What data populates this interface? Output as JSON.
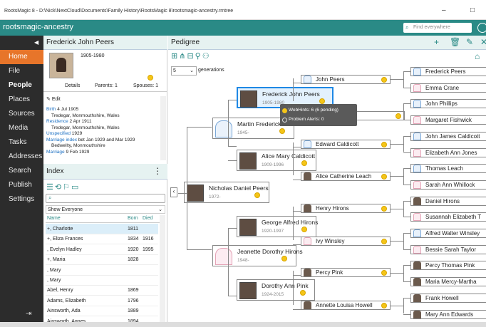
{
  "window": {
    "title": "RootsMagic 8 - D:\\Nick\\NextCloud\\Documents\\Family History\\RootsMagic 8\\rootsmagic-ancestry.rmtree",
    "minimize": "–",
    "restore": "□"
  },
  "appbar": {
    "name": "rootsmagic-ancestry",
    "search_placeholder": "Find everywhere"
  },
  "sidebar": {
    "items": [
      "Home",
      "File",
      "People",
      "Places",
      "Sources",
      "Media",
      "Tasks",
      "Addresses",
      "Search",
      "Publish",
      "Settings"
    ],
    "active": "Home",
    "current": "People"
  },
  "person": {
    "name": "Frederick John Peers",
    "years": "1905-1980",
    "tabs": {
      "details": "Details",
      "parents": "Parents: 1",
      "spouses": "Spouses: 1"
    },
    "edit": "Edit",
    "facts": [
      {
        "label": "Birth",
        "value": "4 Jul 1905"
      },
      {
        "label": "",
        "value": "Tredegar, Monmouthshire, Wales"
      },
      {
        "label": "Residence",
        "value": "2 Apr 1911"
      },
      {
        "label": "",
        "value": "Tredegar, Monmouthshire, Wales"
      },
      {
        "label": "Unspecified",
        "value": "1929"
      },
      {
        "label": "Marriage index",
        "value": "bet Jan 1929 and Mar 1929"
      },
      {
        "label": "",
        "value": "Bedwellty, Monmouthshire"
      },
      {
        "label": "Marriage",
        "value": "9 Feb 1929"
      }
    ]
  },
  "index": {
    "title": "Index",
    "filter": "Show Everyone",
    "cols": {
      "name": "Name",
      "born": "Born",
      "died": "Died"
    },
    "rows": [
      {
        "name": "+, Charlotte",
        "born": "1811",
        "died": ""
      },
      {
        "name": "+, Eliza Frances",
        "born": "1834",
        "died": "1916"
      },
      {
        "name": ", Evelyn Hadley",
        "born": "1920",
        "died": "1995"
      },
      {
        "name": "+, Maria",
        "born": "1828",
        "died": ""
      },
      {
        "name": ", Mary",
        "born": "",
        "died": ""
      },
      {
        "name": ", Mary",
        "born": "",
        "died": ""
      },
      {
        "name": "Abel, Henry",
        "born": "1869",
        "died": ""
      },
      {
        "name": "Adams, Elizabeth",
        "born": "1796",
        "died": ""
      },
      {
        "name": "Ainsworth, Ada",
        "born": "1889",
        "died": ""
      },
      {
        "name": "Ainsworth, Agnes",
        "born": "1894",
        "died": ""
      }
    ]
  },
  "pedigree": {
    "title": "Pedigree",
    "generations_value": "5",
    "generations_label": "generations",
    "root": {
      "name": "Nicholas Daniel Peers",
      "years": "1972-"
    },
    "father": {
      "name": "Martin Frederick Peers",
      "years": "1945-"
    },
    "mother": {
      "name": "Jeanette Dorothy Hirons",
      "years": "1948-"
    },
    "pgf": {
      "name": "Frederick John Peers",
      "years": "1905-1980"
    },
    "pgm": {
      "name": "Alice Mary Caldicott",
      "years": "1909-1996"
    },
    "mgf": {
      "name": "George Alfred Hirons",
      "years": "1920-1997"
    },
    "mgm": {
      "name": "Dorothy Ann Pink",
      "years": "1924-2015"
    },
    "g4": [
      "John Peers",
      "Peers",
      "Edward Caldicott",
      "Alice Catherine Leach",
      "Henry Hirons",
      "Ivy Winsley",
      "Percy Pink",
      "Annette Louisa Howell"
    ],
    "g5": [
      "Frederick Peers",
      "Emma Crane",
      "John Phillips",
      "Margaret Fishwick",
      "John James Caldicott",
      "Elizabeth Ann Jones",
      "Thomas Leach",
      "Sarah Ann Whillock",
      "Daniel Hirons",
      "Susannah Elizabeth T",
      "Alfred Walter Winsley",
      "Bessie Sarah Taylor",
      "Percy Thomas Pink",
      "Maria Mercy-Martha",
      "Frank Howell",
      "Mary Ann Edwards"
    ],
    "tooltip": {
      "webhints": "WebHints: 6 (6 pending)",
      "alerts": "Problem Alerts: 0"
    }
  }
}
